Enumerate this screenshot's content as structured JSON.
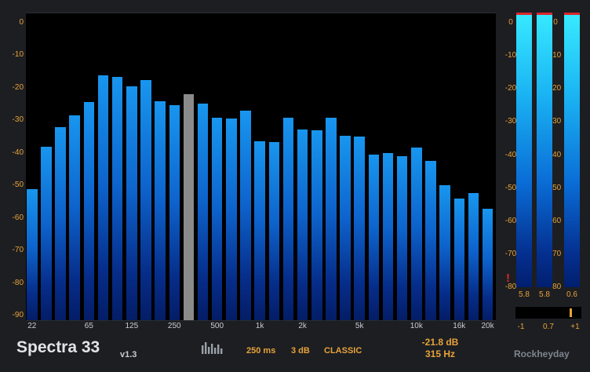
{
  "app": {
    "title": "Spectra 33",
    "version": "v1.3",
    "brand": "Rockheyday"
  },
  "settings": {
    "mode_icon": "spectrum-bars-icon",
    "response_time": "250 ms",
    "slope": "3 dB",
    "style": "CLASSIC"
  },
  "readout": {
    "level": "-21.8 dB",
    "frequency": "315 Hz"
  },
  "colors": {
    "accent": "#e8a23a",
    "bar_top": "#1896ef",
    "bar_bottom": "#041d66",
    "selected_bar": "#8a8a8a",
    "meter_top": "#38eaff",
    "peak": "#d9262e",
    "clip_indicator": "#d9262e"
  },
  "chart_data": {
    "type": "bar",
    "ylim": [
      -90,
      0
    ],
    "y_ticks": [
      "0",
      "-10",
      "-20",
      "-30",
      "-40",
      "-50",
      "-60",
      "-70",
      "-80",
      "-90"
    ],
    "x_ticks": [
      "22",
      "65",
      "125",
      "250",
      "500",
      "1k",
      "2k",
      "5k",
      "10k",
      "16k",
      "20k"
    ],
    "bands": 33,
    "values": [
      -51,
      -38,
      -31.8,
      -28.2,
      -24.2,
      -16,
      -16.5,
      -19.2,
      -17.3,
      -23.8,
      -25,
      -21.8,
      -24.5,
      -29,
      -29.3,
      -26.7,
      -36.1,
      -36.4,
      -29,
      -32.6,
      -32.8,
      -29,
      -34.4,
      -34.7,
      -40.4,
      -39.7,
      -40.7,
      -38.2,
      -42.3,
      -49.7,
      -53.8,
      -52.1,
      -57
    ],
    "selected_index": 11,
    "selected_value": -21.8,
    "selected_frequency": "315 Hz"
  },
  "meters": {
    "scale_ticks": [
      "0",
      "-10",
      "-20",
      "-30",
      "-40",
      "-50",
      "-60",
      "-70",
      "-80"
    ],
    "channels": [
      {
        "level": 0,
        "peak": 0,
        "value_label": "5.8"
      },
      {
        "level": 0,
        "peak": 0,
        "value_label": "5.8"
      },
      {
        "level": -0.6,
        "peak": 0,
        "value_label": "0.6"
      }
    ],
    "clip_mark": "!"
  },
  "correlation": {
    "value": 0.7,
    "value_label": "0.7",
    "min_label": "-1",
    "max_label": "+1"
  }
}
